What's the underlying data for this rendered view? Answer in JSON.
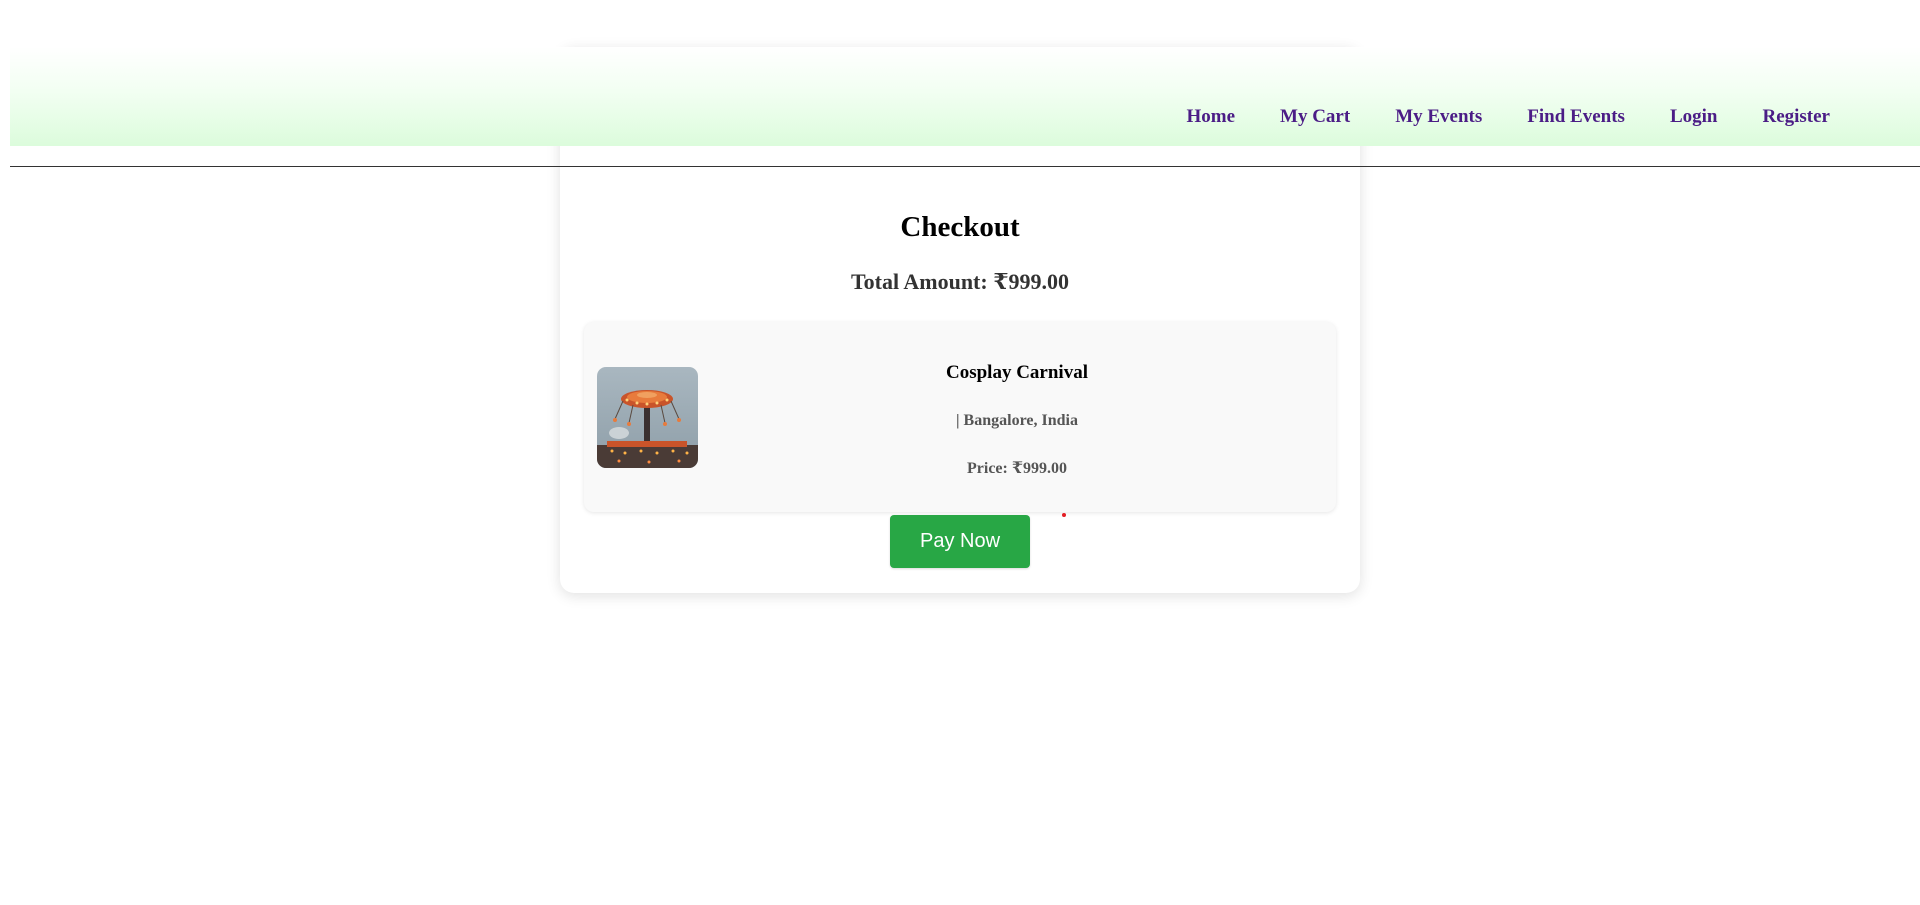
{
  "header": {
    "nav": [
      {
        "label": "Home"
      },
      {
        "label": "My Cart"
      },
      {
        "label": "My Events"
      },
      {
        "label": "Find Events"
      },
      {
        "label": "Login"
      },
      {
        "label": "Register"
      }
    ]
  },
  "checkout": {
    "title": "Checkout",
    "total_label": "Total Amount:",
    "total_value": "₹999.00",
    "item": {
      "name": "Cosplay Carnival",
      "location": "| Bangalore, India",
      "price_label": "Price:",
      "price_value": "₹999.00",
      "image_alt": "carnival swing ride photo"
    },
    "pay_button": "Pay Now"
  },
  "colors": {
    "nav_link": "#4b1d86",
    "header_gradient_end": "#dcfcdc",
    "pay_button": "#28a745",
    "cursor_marker": "#e31e24"
  },
  "icons": [
    "carnival-image"
  ]
}
